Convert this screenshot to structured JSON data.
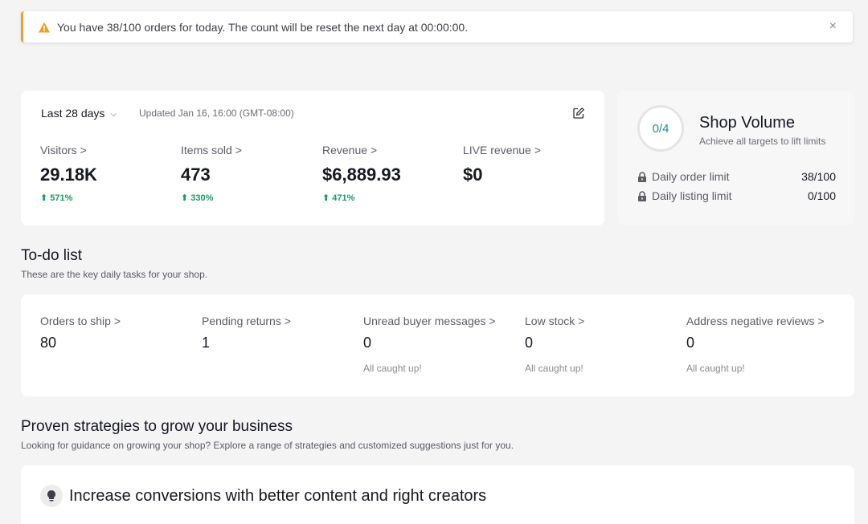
{
  "banner": {
    "message": "You have 38/100 orders for today. The count will be reset the next day at 00:00:00.",
    "close": "×",
    "accent": "#f0a020"
  },
  "performance": {
    "range_label": "Last 28 days",
    "range_chevron": "⌵",
    "updated": "Updated Jan 16, 16:00 (GMT-08:00)",
    "metrics": [
      {
        "label": "Visitors >",
        "value": "29.18K",
        "delta": "⬆ 571%"
      },
      {
        "label": "Items sold >",
        "value": "473",
        "delta": "⬆ 330%"
      },
      {
        "label": "Revenue >",
        "value": "$6,889.93",
        "delta": "⬆ 471%"
      },
      {
        "label": "LIVE revenue >",
        "value": "$0",
        "delta": ""
      }
    ],
    "positive_color": "#1a9c62"
  },
  "shop_volume": {
    "progress": "0/4",
    "title": "Shop Volume",
    "subtitle": "Achieve all targets to lift limits",
    "limits": [
      {
        "name": "Daily order limit",
        "used": "38",
        "total": "/100"
      },
      {
        "name": "Daily listing limit",
        "used": "0",
        "total": "/100"
      }
    ]
  },
  "todo": {
    "title": "To-do list",
    "subtitle": "These are the key daily tasks for your shop.",
    "items": [
      {
        "label": "Orders to ship >",
        "value": "80",
        "note": ""
      },
      {
        "label": "Pending returns >",
        "value": "1",
        "note": ""
      },
      {
        "label": "Unread buyer messages >",
        "value": "0",
        "note": "All caught up!"
      },
      {
        "label": "Low stock >",
        "value": "0",
        "note": "All caught up!"
      },
      {
        "label": "Address negative reviews >",
        "value": "0",
        "note": "All caught up!"
      }
    ]
  },
  "strategies": {
    "title": "Proven strategies to grow your business",
    "subtitle": "Looking for guidance on growing your shop? Explore a range of strategies and customized suggestions just for you.",
    "card_title": "Increase conversions with better content and right creators"
  }
}
